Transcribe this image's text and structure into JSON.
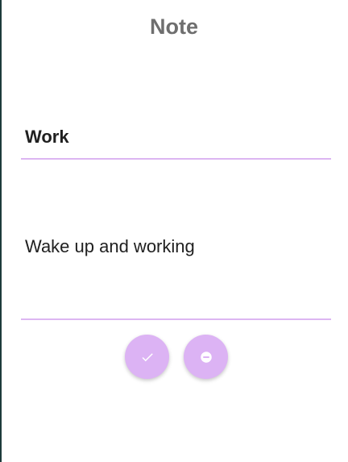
{
  "header": {
    "title": "Note"
  },
  "note": {
    "title_value": "Work",
    "body_value": "Wake up and working"
  },
  "actions": [
    {
      "icon": "check-icon"
    },
    {
      "icon": "minus-circle-icon"
    }
  ],
  "colors": {
    "accent": "#dcb3f4",
    "underline": "#dcb6f2",
    "title_text": "#6e6e6e",
    "body_text": "#202020"
  }
}
